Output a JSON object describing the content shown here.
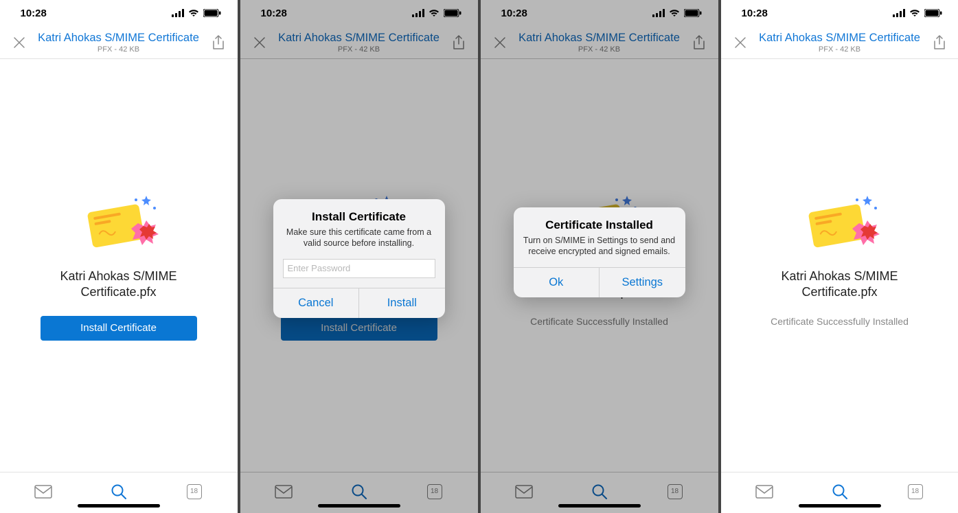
{
  "status": {
    "time": "10:28"
  },
  "header": {
    "title": "Katri Ahokas S/MIME Certificate",
    "sub": "PFX - 42 KB"
  },
  "file": {
    "name": "Katri Ahokas S/MIME\nCertificate.pfx"
  },
  "buttons": {
    "install": "Install Certificate"
  },
  "success": {
    "text": "Certificate Successfully Installed"
  },
  "alert_install": {
    "title": "Install Certificate",
    "message": "Make sure this certificate came from a valid source before installing.",
    "placeholder": "Enter Password",
    "cancel": "Cancel",
    "ok": "Install"
  },
  "alert_done": {
    "title": "Certificate Installed",
    "message": "Turn on S/MIME in Settings to send and receive encrypted and signed emails.",
    "ok": "Ok",
    "settings": "Settings"
  },
  "tabbar": {
    "calendar_day": "18"
  }
}
